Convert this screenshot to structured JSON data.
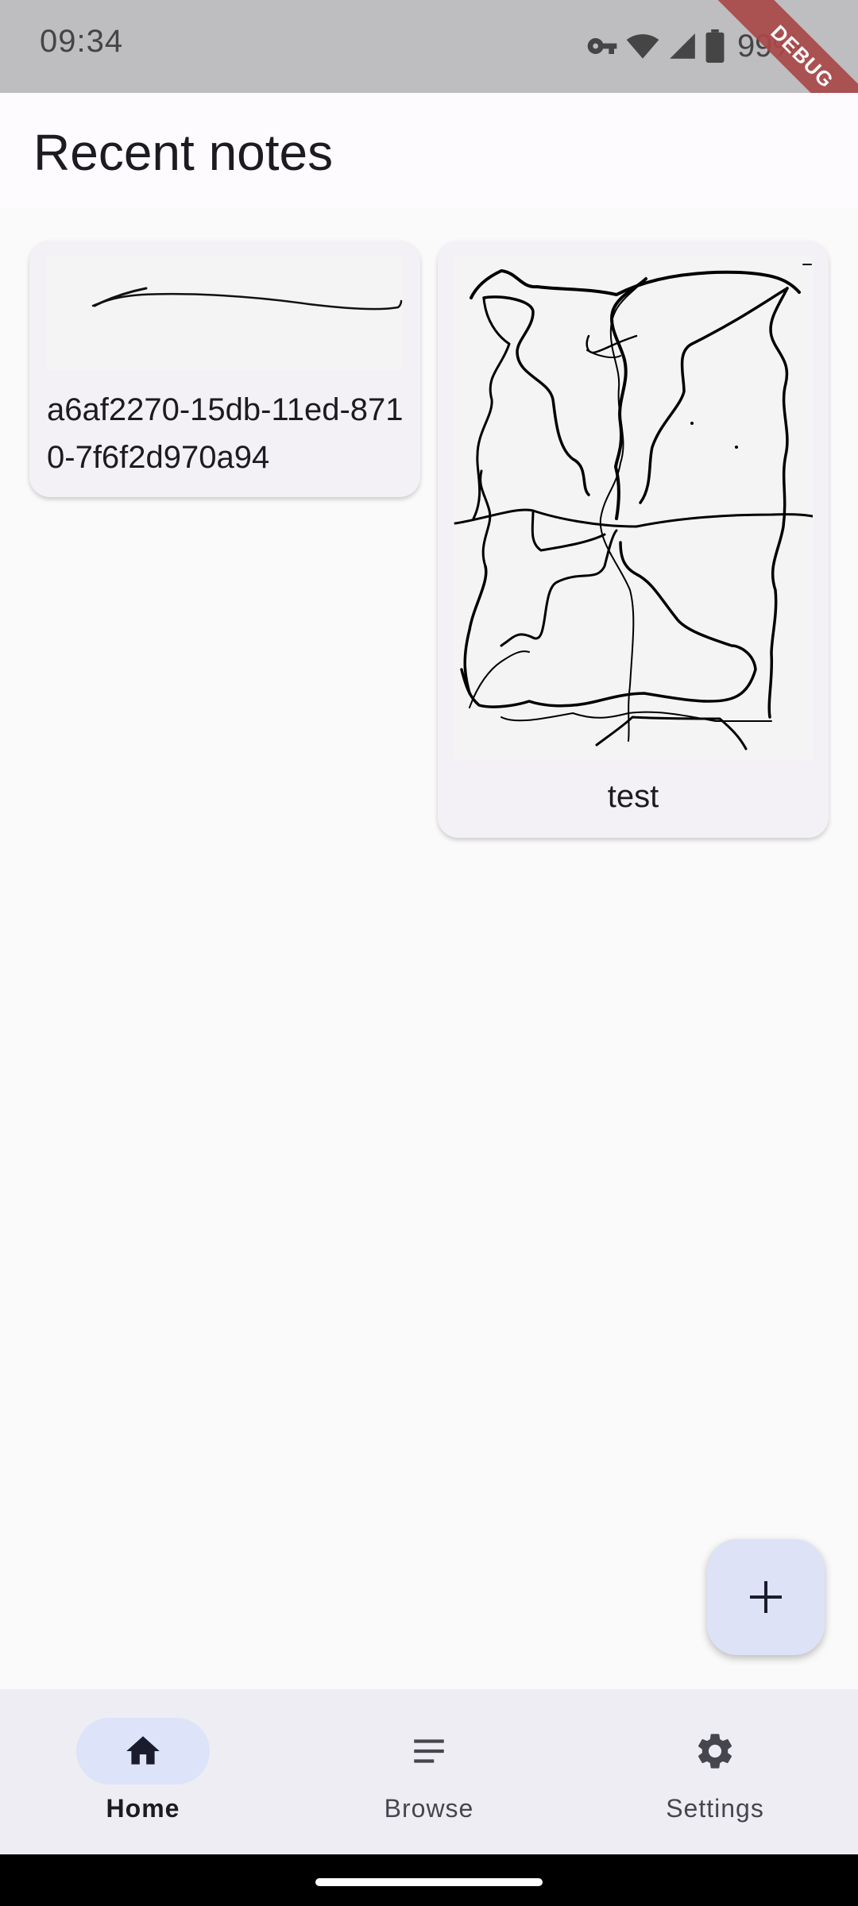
{
  "status_bar": {
    "time": "09:34",
    "battery_percent": "99%",
    "debug_label": "DEBUG",
    "icons": [
      "vpn-key-icon",
      "wifi-icon",
      "signal-icon",
      "battery-icon"
    ]
  },
  "app_bar": {
    "title": "Recent notes"
  },
  "notes": [
    {
      "title": "a6af2270-15db-11ed-8710-7f6f2d970a94",
      "preview": "sketch-preview"
    },
    {
      "title": "test",
      "preview": "sketch-preview"
    }
  ],
  "fab": {
    "icon": "add-icon"
  },
  "bottom_nav": {
    "items": [
      {
        "label": "Home",
        "icon": "home-icon",
        "active": true
      },
      {
        "label": "Browse",
        "icon": "list-icon",
        "active": false
      },
      {
        "label": "Settings",
        "icon": "gear-icon",
        "active": false
      }
    ]
  },
  "colors": {
    "status_bar": "#bebdbf",
    "card": "#f3f1f6",
    "fab": "#dee2f7",
    "nav_background": "#eeedf4",
    "nav_active_indicator": "#dde3f8",
    "debug_banner": "#a94848"
  }
}
